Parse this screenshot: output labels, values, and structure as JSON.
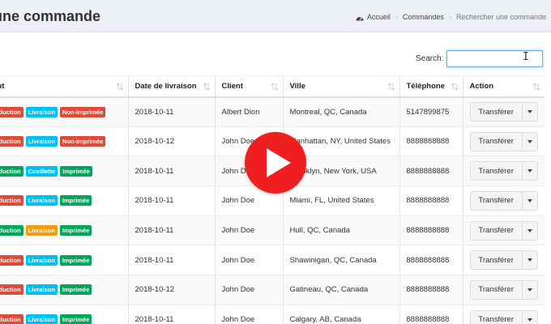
{
  "header": {
    "title": "une commande",
    "breadcrumb": [
      {
        "label": "Accueil",
        "icon": "dashboard-icon"
      },
      {
        "label": "Commandes"
      },
      {
        "label": "Rechercher une commande"
      }
    ]
  },
  "search": {
    "label": "Search:",
    "value": ""
  },
  "table": {
    "columns": [
      "atut",
      "Date de livraison",
      "Client",
      "Ville",
      "Téléphone",
      "Action"
    ],
    "action_label": "Transférer",
    "rows": [
      {
        "status": [
          {
            "text": "roduction",
            "color": "#dd4b39"
          },
          {
            "text": "Livraison",
            "color": "#00c0ef"
          },
          {
            "text": "Non-imprimée",
            "color": "#dd4b39"
          }
        ],
        "date": "2018-10-11",
        "client": "Albert Dion",
        "city": "Montreal, QC, Canada",
        "phone": "5147899875"
      },
      {
        "status": [
          {
            "text": "roduction",
            "color": "#dd4b39"
          },
          {
            "text": "Livraison",
            "color": "#00c0ef"
          },
          {
            "text": "Non-imprimée",
            "color": "#dd4b39"
          }
        ],
        "date": "2018-10-12",
        "client": "John Doe",
        "city": "Manhattan, NY, United States",
        "phone": "8888888888"
      },
      {
        "status": [
          {
            "text": "roduction",
            "color": "#00a65a"
          },
          {
            "text": "Cueillette",
            "color": "#00c0ef"
          },
          {
            "text": "Imprimée",
            "color": "#00a65a"
          }
        ],
        "date": "2018-10-11",
        "client": "John Doe",
        "city": "Brooklyn, New York, USA",
        "phone": "8888888888"
      },
      {
        "status": [
          {
            "text": "roduction",
            "color": "#dd4b39"
          },
          {
            "text": "Livraison",
            "color": "#00c0ef"
          },
          {
            "text": "Imprimée",
            "color": "#00a65a"
          }
        ],
        "date": "2018-10-11",
        "client": "John Doe",
        "city": "Miami, FL, United States",
        "phone": "8888888888"
      },
      {
        "status": [
          {
            "text": "roduction",
            "color": "#00a65a"
          },
          {
            "text": "Livraison",
            "color": "#f39c12"
          },
          {
            "text": "Imprimée",
            "color": "#00a65a"
          }
        ],
        "date": "2018-10-11",
        "client": "John Doe",
        "city": "Hull, QC, Canada",
        "phone": "8888888888"
      },
      {
        "status": [
          {
            "text": "roduction",
            "color": "#dd4b39"
          },
          {
            "text": "Livraison",
            "color": "#00c0ef"
          },
          {
            "text": "Imprimée",
            "color": "#00a65a"
          }
        ],
        "date": "2018-10-11",
        "client": "John Doe",
        "city": "Shawinigan, QC, Canada",
        "phone": "8888888888"
      },
      {
        "status": [
          {
            "text": "roduction",
            "color": "#dd4b39"
          },
          {
            "text": "Livraison",
            "color": "#00c0ef"
          },
          {
            "text": "Imprimée",
            "color": "#00a65a"
          }
        ],
        "date": "2018-10-12",
        "client": "John Doe",
        "city": "Gatineau, QC, Canada",
        "phone": "8888888888"
      },
      {
        "status": [
          {
            "text": "roduction",
            "color": "#dd4b39"
          },
          {
            "text": "Livraison",
            "color": "#00c0ef"
          },
          {
            "text": "Imprimée",
            "color": "#00a65a"
          }
        ],
        "date": "2018-10-11",
        "client": "John Doe",
        "city": "Calgary, AB, Canada",
        "phone": "8888888888"
      }
    ]
  },
  "overlay": {
    "icon": "play-icon",
    "color": "#f01f1f"
  }
}
